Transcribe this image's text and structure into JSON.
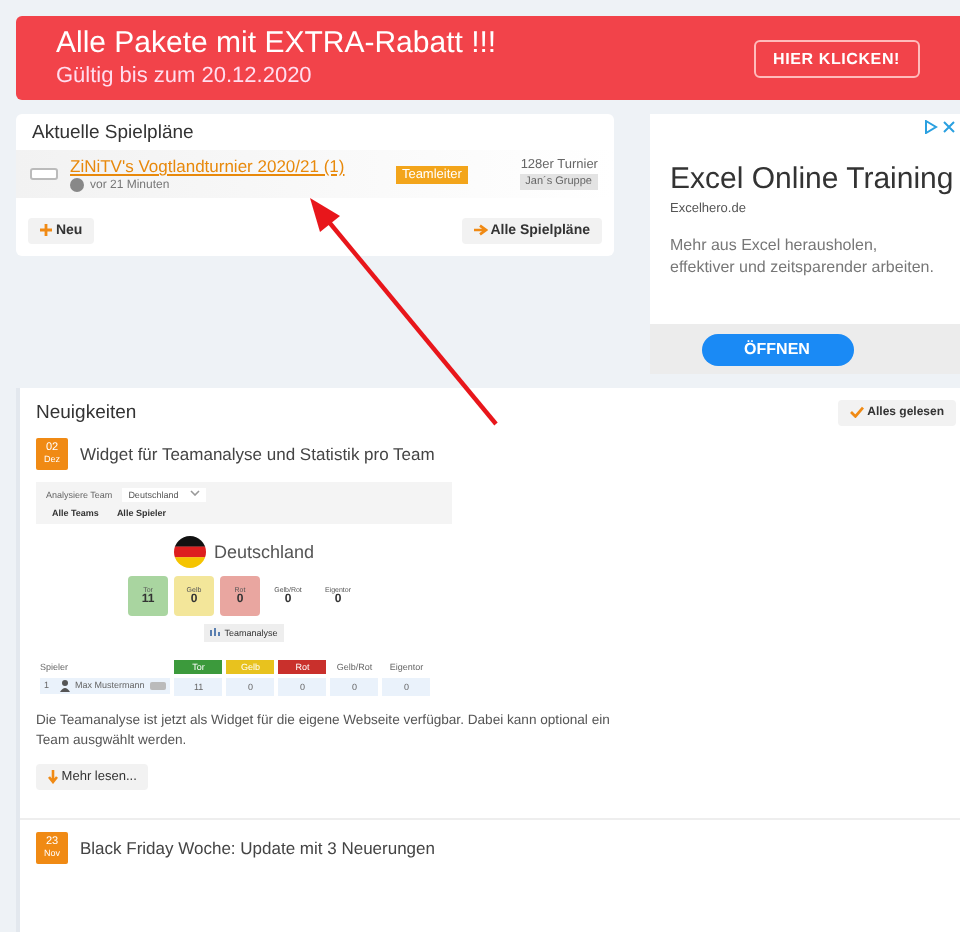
{
  "banner": {
    "title": "Alle Pakete mit EXTRA-Rabatt !!!",
    "subtitle": "Gültig bis zum 20.12.2020",
    "button": "HIER KLICKEN!"
  },
  "schedules": {
    "title": "Aktuelle Spielpläne",
    "item": {
      "name": "ZiNiTV's Vogtlandturnier 2020/21 (1)",
      "time": "vor 21 Minuten",
      "role": "Teamleiter",
      "type": "128er Turnier",
      "group": "Jan´s Gruppe"
    },
    "buttons": [
      "Neu",
      "Alle Spielpläne"
    ]
  },
  "ad": {
    "title": "Excel Online Training",
    "domain": "Excelhero.de",
    "text": "Mehr aus Excel herausholen, effektiver und zeitsparender arbeiten.",
    "button": "ÖFFNEN"
  },
  "news": {
    "title": "Neuigkeiten",
    "mark_read": "Alles gelesen",
    "items": [
      {
        "day": "02",
        "month": "Dez",
        "title": "Widget für Teamanalyse und Statistik pro Team",
        "widget": {
          "team_label": "Analysiere Team",
          "team_value": "Deutschland",
          "tabs": [
            "Alle Teams",
            "Alle Spieler"
          ],
          "team_name": "Deutschland",
          "stats": [
            {
              "label": "Tor",
              "value": "11",
              "color": "#a9d5a0"
            },
            {
              "label": "Gelb",
              "value": "0",
              "color": "#f3e69a"
            },
            {
              "label": "Rot",
              "value": "0",
              "color": "#e9a6a0"
            },
            {
              "label": "Gelb/Rot",
              "value": "0"
            },
            {
              "label": "Eigentor",
              "value": "0"
            }
          ],
          "analysis_button": "Teamanalyse",
          "table": {
            "columns": [
              {
                "label": "Spieler"
              },
              {
                "label": "Tor",
                "color": "#3c9a3c"
              },
              {
                "label": "Gelb",
                "color": "#e8c21e"
              },
              {
                "label": "Rot",
                "color": "#c9302c"
              },
              {
                "label": "Gelb/Rot"
              },
              {
                "label": "Eigentor"
              }
            ],
            "rows": [
              {
                "rank": "1",
                "player": "Max Mustermann",
                "values": [
                  "11",
                  "0",
                  "0",
                  "0",
                  "0"
                ]
              }
            ]
          }
        },
        "text": "Die Teamanalyse ist jetzt als Widget für die eigene Webseite verfügbar. Dabei kann optional ein Team ausgwählt werden.",
        "button": "Mehr lesen..."
      },
      {
        "day": "23",
        "month": "Nov",
        "title": "Black Friday Woche: Update mit 3 Neuerungen"
      }
    ]
  }
}
